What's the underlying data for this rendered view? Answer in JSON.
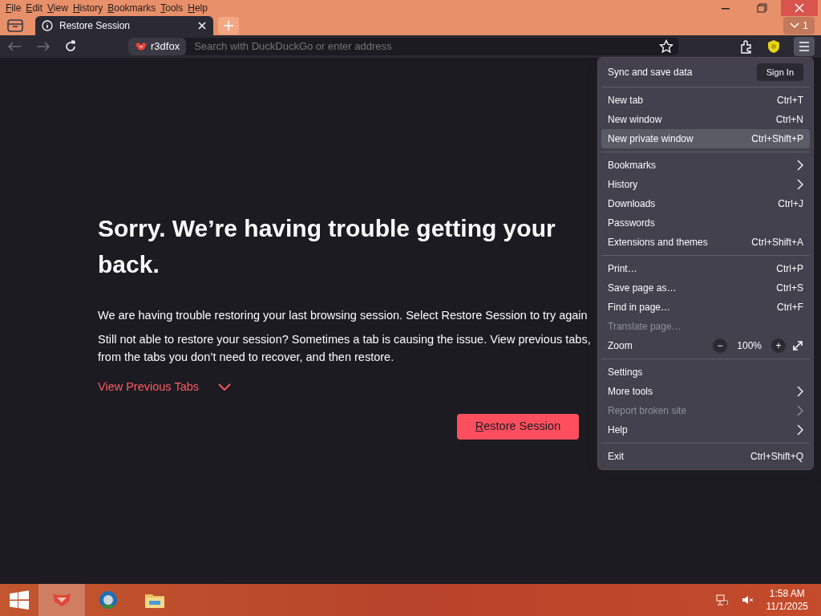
{
  "menubar": [
    "File",
    "Edit",
    "View",
    "History",
    "Bookmarks",
    "Tools",
    "Help"
  ],
  "tabs": [
    {
      "label": "Restore Session",
      "selected": true
    }
  ],
  "tab_count": "1",
  "address_bar": {
    "identity": "r3dfox",
    "placeholder": "Search with DuckDuckGo or enter address"
  },
  "page": {
    "heading_lines": [
      "Sorry. We’re having trouble getting your",
      "back."
    ],
    "paragraph_1": "We are having trouble restoring your last browsing session. Select Restore Session to try again",
    "paragraph_2_lines": [
      "Still not able to restore your session? Sometimes a tab is causing the issue. View previous tabs,",
      "from the tabs you don’t need to recover, and then restore."
    ],
    "toggle_link": "View Previous Tabs",
    "expanded": false,
    "restore_button": "Restore Session"
  },
  "app_menu": {
    "sync_label": "Sync and save data",
    "sign_in": "Sign In",
    "items": [
      {
        "kind": "separator"
      },
      {
        "kind": "item",
        "label": "New tab",
        "shortcut": "Ctrl+T",
        "selected": false,
        "disabled": false
      },
      {
        "kind": "item",
        "label": "New window",
        "shortcut": "Ctrl+N",
        "selected": false,
        "disabled": false
      },
      {
        "kind": "item",
        "label": "New private window",
        "shortcut": "Ctrl+Shift+P",
        "selected": true,
        "disabled": false
      },
      {
        "kind": "separator"
      },
      {
        "kind": "submenu",
        "label": "Bookmarks",
        "selected": false,
        "disabled": false
      },
      {
        "kind": "submenu",
        "label": "History",
        "selected": false,
        "disabled": false
      },
      {
        "kind": "item",
        "label": "Downloads",
        "shortcut": "Ctrl+J",
        "selected": false,
        "disabled": false
      },
      {
        "kind": "item",
        "label": "Passwords",
        "selected": false,
        "disabled": false
      },
      {
        "kind": "item",
        "label": "Extensions and themes",
        "shortcut": "Ctrl+Shift+A",
        "selected": false,
        "disabled": false
      },
      {
        "kind": "separator"
      },
      {
        "kind": "item",
        "label": "Print…",
        "shortcut": "Ctrl+P",
        "selected": false,
        "disabled": false
      },
      {
        "kind": "item",
        "label": "Save page as…",
        "shortcut": "Ctrl+S",
        "selected": false,
        "disabled": false
      },
      {
        "kind": "item",
        "label": "Find in page…",
        "shortcut": "Ctrl+F",
        "selected": false,
        "disabled": false
      },
      {
        "kind": "item",
        "label": "Translate page…",
        "selected": false,
        "disabled": true
      },
      {
        "kind": "zoom",
        "label": "Zoom",
        "minus": "−",
        "value": "100%",
        "plus": "+"
      },
      {
        "kind": "separator"
      },
      {
        "kind": "item",
        "label": "Settings",
        "selected": false,
        "disabled": false
      },
      {
        "kind": "submenu",
        "label": "More tools",
        "selected": false,
        "disabled": false
      },
      {
        "kind": "submenu",
        "label": "Report broken site",
        "selected": false,
        "disabled": true
      },
      {
        "kind": "submenu",
        "label": "Help",
        "selected": false,
        "disabled": false
      },
      {
        "kind": "separator"
      },
      {
        "kind": "item",
        "label": "Exit",
        "shortcut": "Ctrl+Shift+Q",
        "selected": false,
        "disabled": false
      }
    ]
  },
  "taskbar": {
    "apps": [
      {
        "kind": "fox",
        "selected": true
      },
      {
        "kind": "globe",
        "selected": false
      },
      {
        "kind": "folder",
        "selected": false
      }
    ],
    "time": "1:58 AM",
    "date": "11/1/2025"
  }
}
